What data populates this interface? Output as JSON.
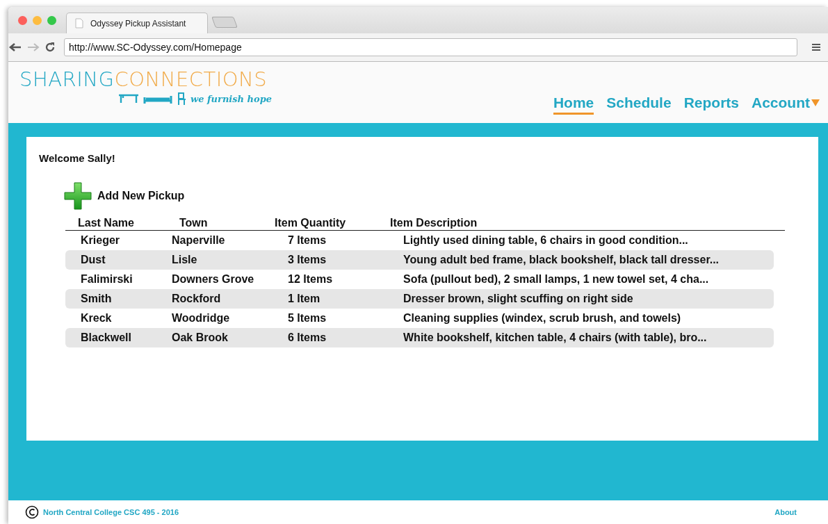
{
  "browser": {
    "tab_title": "Odyssey Pickup Assistant",
    "url": "http://www.SC-Odyssey.com/Homepage"
  },
  "logo": {
    "word_1": "SHARING",
    "word_2": "CONNECTIONS",
    "tagline": "we furnish hope"
  },
  "nav": [
    {
      "label": "Home",
      "selected": true,
      "dropdown": false
    },
    {
      "label": "Schedule",
      "selected": false,
      "dropdown": false
    },
    {
      "label": "Reports",
      "selected": false,
      "dropdown": false
    },
    {
      "label": "Account",
      "selected": false,
      "dropdown": true
    }
  ],
  "welcome": "Welcome Sally!",
  "add_button": "Add New Pickup",
  "table": {
    "columns": [
      "Last Name",
      "Town",
      "Item Quantity",
      "Item Description"
    ],
    "rows": [
      [
        "Krieger",
        "Naperville",
        "7 Items",
        "Lightly used dining table, 6 chairs in good condition..."
      ],
      [
        "Dust",
        "Lisle",
        "3 Items",
        "Young adult bed frame, black bookshelf, black tall dresser..."
      ],
      [
        "Falimirski",
        "Downers Grove",
        "12 Items",
        "Sofa (pullout bed), 2 small lamps, 1 new towel set, 4 cha..."
      ],
      [
        "Smith",
        "Rockford",
        "1 Item",
        "Dresser brown, slight scuffing on right side"
      ],
      [
        "Kreck",
        "Woodridge",
        "5 Items",
        "Cleaning supplies (windex, scrub brush, and towels)"
      ],
      [
        "Blackwell",
        "Oak Brook",
        "6 Items",
        "White bookshelf, kitchen table, 4 chairs (with table), bro..."
      ]
    ]
  },
  "footer": {
    "credit": "North Central College CSC 495 - 2016",
    "link": "About"
  }
}
